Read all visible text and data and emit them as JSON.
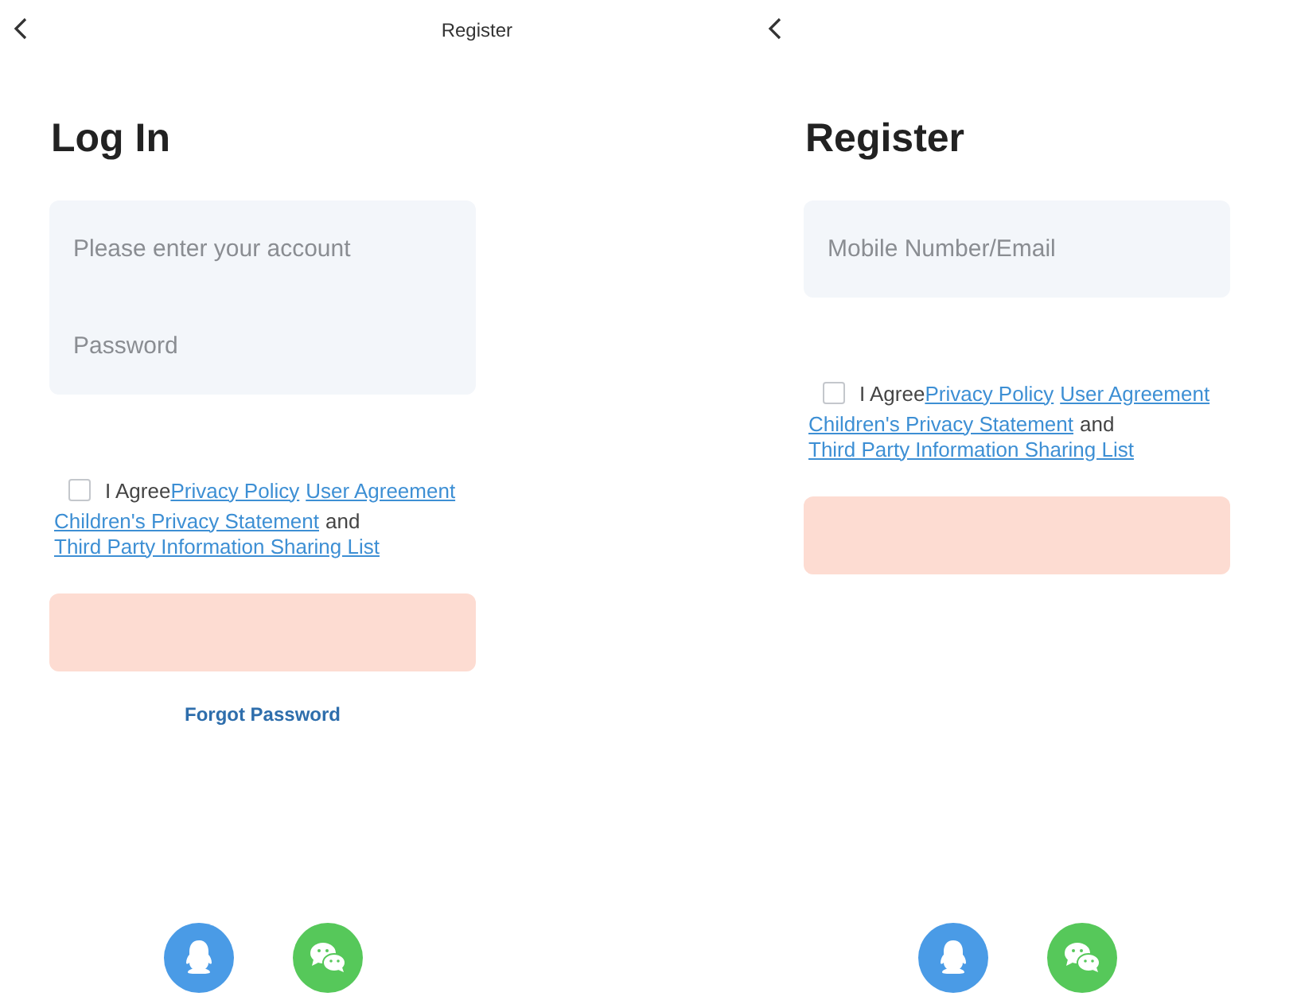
{
  "screens": [
    {
      "top_action": "Register",
      "title": "Log In",
      "fields": [
        {
          "placeholder": "Please enter your account"
        },
        {
          "placeholder": "Password"
        }
      ],
      "agreement": {
        "checked": false,
        "lines": [
          [
            {
              "kind": "text",
              "text": "I Agree"
            },
            {
              "kind": "link",
              "text": "Privacy Policy"
            },
            {
              "kind": "link",
              "text": "User Agreement"
            }
          ],
          [
            {
              "kind": "link",
              "text": "Children's Privacy Statement"
            },
            {
              "kind": "text",
              "text": "and"
            }
          ],
          [
            {
              "kind": "link",
              "text": "Third Party Information Sharing List"
            }
          ]
        ]
      },
      "submit": {
        "disabled": true
      },
      "secondary_link": "Forgot Password",
      "social": [
        {
          "kind": "qq"
        },
        {
          "kind": "wechat"
        }
      ]
    },
    {
      "title": "Register",
      "fields": [
        {
          "placeholder": "Mobile Number/Email"
        }
      ],
      "agreement": {
        "checked": false,
        "lines": [
          [
            {
              "kind": "text",
              "text": "I Agree"
            },
            {
              "kind": "link",
              "text": "Privacy Policy"
            },
            {
              "kind": "link",
              "text": "User Agreement"
            }
          ],
          [
            {
              "kind": "link",
              "text": "Children's Privacy Statement"
            },
            {
              "kind": "text",
              "text": "and"
            }
          ],
          [
            {
              "kind": "link",
              "text": "Third Party Information Sharing List"
            }
          ]
        ]
      },
      "submit": {
        "disabled": true
      },
      "social": [
        {
          "kind": "qq"
        },
        {
          "kind": "wechat"
        }
      ]
    }
  ]
}
